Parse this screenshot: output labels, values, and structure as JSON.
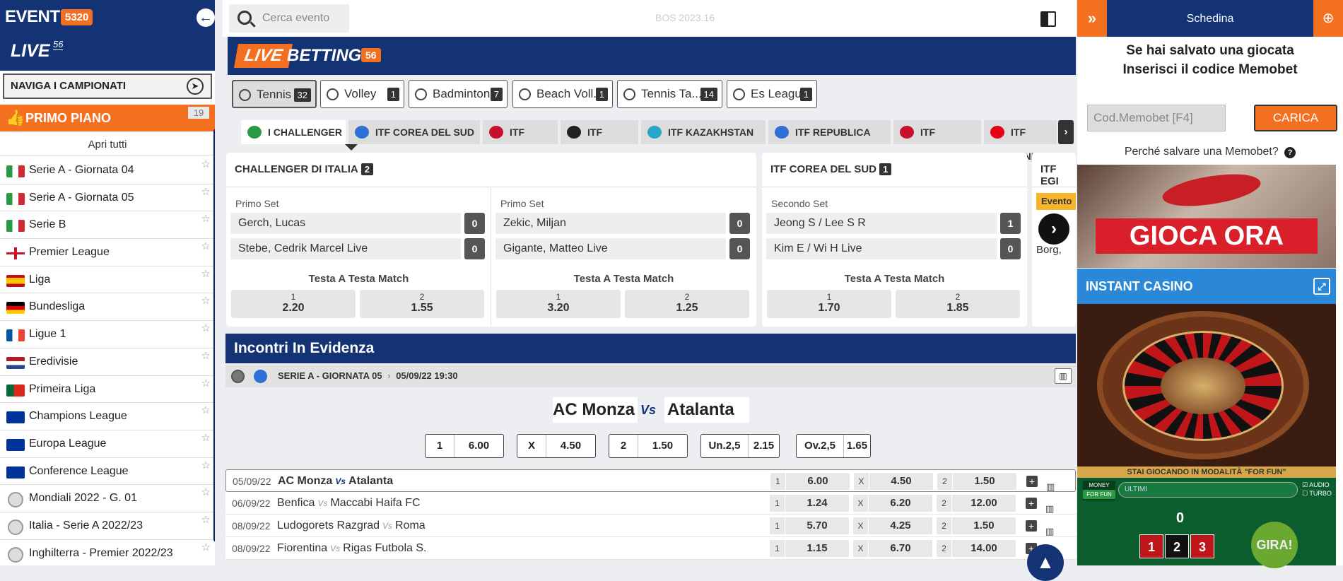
{
  "sidebar": {
    "eventi_label": "EVENTI",
    "eventi_count": "5320",
    "live_label": "LIVE",
    "live_count": "56",
    "naviga_label": "NAVIGA I CAMPIONATI",
    "primo_piano_label": "PRIMO PIANO",
    "primo_piano_count": "19",
    "apri_tutti": "Apri tutti",
    "items": [
      {
        "label": "Serie A - Giornata 04",
        "flag": "it"
      },
      {
        "label": "Serie A - Giornata 05",
        "flag": "it"
      },
      {
        "label": "Serie B",
        "flag": "it"
      },
      {
        "label": "Premier League",
        "flag": "en"
      },
      {
        "label": "Liga",
        "flag": "es"
      },
      {
        "label": "Bundesliga",
        "flag": "de"
      },
      {
        "label": "Ligue 1",
        "flag": "fr"
      },
      {
        "label": "Eredivisie",
        "flag": "nl"
      },
      {
        "label": "Primeira Liga",
        "flag": "pt"
      },
      {
        "label": "Champions League",
        "flag": "eu"
      },
      {
        "label": "Europa League",
        "flag": "eu"
      },
      {
        "label": "Conference League",
        "flag": "eu"
      },
      {
        "label": "Mondiali 2022 - G. 01",
        "flag": "ball"
      },
      {
        "label": "Italia - Serie A 2022/23",
        "flag": "ball"
      },
      {
        "label": "Inghilterra - Premier 2022/23",
        "flag": "ball"
      }
    ]
  },
  "topbar": {
    "search_placeholder": "Cerca evento",
    "version": "BOS 2023.16"
  },
  "livebar": {
    "logo_live": "LIVE",
    "logo_betting": "BETTING",
    "count": "56"
  },
  "sports": [
    {
      "label": "Tennis",
      "count": "32",
      "active": true
    },
    {
      "label": "Volley",
      "count": "1"
    },
    {
      "label": "Badminton",
      "count": "7"
    },
    {
      "label": "Beach Voll...",
      "count": "1"
    },
    {
      "label": "Tennis Ta...",
      "count": "14"
    },
    {
      "label": "Es League ...",
      "count": "1"
    }
  ],
  "championships": [
    {
      "label": "I CHALLENGER DI ITALIA",
      "active": true,
      "color": "#2b9a44"
    },
    {
      "label": "ITF COREA DEL SUD",
      "color": "#2f6fd6"
    },
    {
      "label": "ITF EGITTO",
      "color": "#c8102e"
    },
    {
      "label": "ITF GERMANIA",
      "color": "#222222"
    },
    {
      "label": "ITF KAZAKHSTAN",
      "color": "#26a6c9"
    },
    {
      "label": "ITF REPUBLICA CECA",
      "color": "#2f6fd6"
    },
    {
      "label": "ITF SLOVENIA",
      "color": "#c8102e"
    },
    {
      "label": "ITF TUNISIA",
      "color": "#e70013"
    }
  ],
  "cards": [
    {
      "title": "CHALLENGER DI ITALIA",
      "count": "2",
      "matches": [
        {
          "set": "Primo Set",
          "p1": "Gerch, Lucas",
          "s1": "0",
          "p2": "Stebe, Cedrik Marcel Live",
          "s2": "0",
          "market": "Testa A Testa Match",
          "o1l": "1",
          "o1": "2.20",
          "o2l": "2",
          "o2": "1.55"
        },
        {
          "set": "Primo Set",
          "p1": "Zekic, Miljan",
          "s1": "0",
          "p2": "Gigante, Matteo Live",
          "s2": "0",
          "market": "Testa A Testa Match",
          "o1l": "1",
          "o1": "3.20",
          "o2l": "2",
          "o2": "1.25"
        }
      ]
    },
    {
      "title": "ITF COREA DEL SUD",
      "count": "1",
      "matches": [
        {
          "set": "Secondo Set",
          "p1": "Jeong S / Lee S R",
          "s1": "1",
          "p2": "Kim E / Wi H Live",
          "s2": "0",
          "market": "Testa A Testa Match",
          "o1l": "1",
          "o1": "1.70",
          "o2l": "2",
          "o2": "1.85"
        }
      ]
    }
  ],
  "partial_card": {
    "title": "ITF EGI",
    "badge": "Evento",
    "p2": "Borg,"
  },
  "evidenza": {
    "title": "Incontri In Evidenza",
    "league": "SERIE A - GIORNATA 05",
    "datetime": "05/09/22 19:30",
    "home": "AC Monza",
    "vs": "Vs",
    "away": "Atalanta",
    "bets": [
      {
        "label": "1",
        "value": "6.00"
      },
      {
        "label": "X",
        "value": "4.50"
      },
      {
        "label": "2",
        "value": "1.50"
      },
      {
        "label": "Un.2,5",
        "value": "2.15"
      },
      {
        "label": "Ov.2,5",
        "value": "1.65"
      }
    ]
  },
  "rows": [
    {
      "date": "05/09/22",
      "home": "AC Monza",
      "away": "Atalanta",
      "bold": true,
      "o1": "6.00",
      "ox": "4.50",
      "o2": "1.50"
    },
    {
      "date": "06/09/22",
      "home": "Benfica",
      "away": "Maccabi Haifa FC",
      "o1": "1.24",
      "ox": "6.20",
      "o2": "12.00"
    },
    {
      "date": "08/09/22",
      "home": "Ludogorets Razgrad",
      "away": "Roma",
      "o1": "5.70",
      "ox": "4.25",
      "o2": "1.50"
    },
    {
      "date": "08/09/22",
      "home": "Fiorentina",
      "away": "Rigas Futbola S.",
      "o1": "1.15",
      "ox": "6.70",
      "o2": "14.00"
    }
  ],
  "odds_keys": {
    "k1": "1",
    "kx": "X",
    "k2": "2"
  },
  "right": {
    "title": "Schedina",
    "msg_line1": "Se hai salvato una giocata",
    "msg_line2": "Inserisci il codice Memobet",
    "memo_placeholder": "Cod.Memobet [F4]",
    "carica": "CARICA",
    "why": "Perché salvare una Memobet?",
    "gioca": "GIOCA ORA",
    "casino_title": "INSTANT CASINO",
    "for_fun_strip": "STAI GIOCANDO IN MODALITÀ \"FOR FUN\"",
    "money": "MONEY",
    "for_fun": "FOR FUN",
    "ultimi": "ULTIMI",
    "audio": "AUDIO",
    "turbo": "TURBO",
    "zero": "0",
    "nums": [
      "1",
      "2",
      "3"
    ],
    "gira": "GIRA!"
  }
}
